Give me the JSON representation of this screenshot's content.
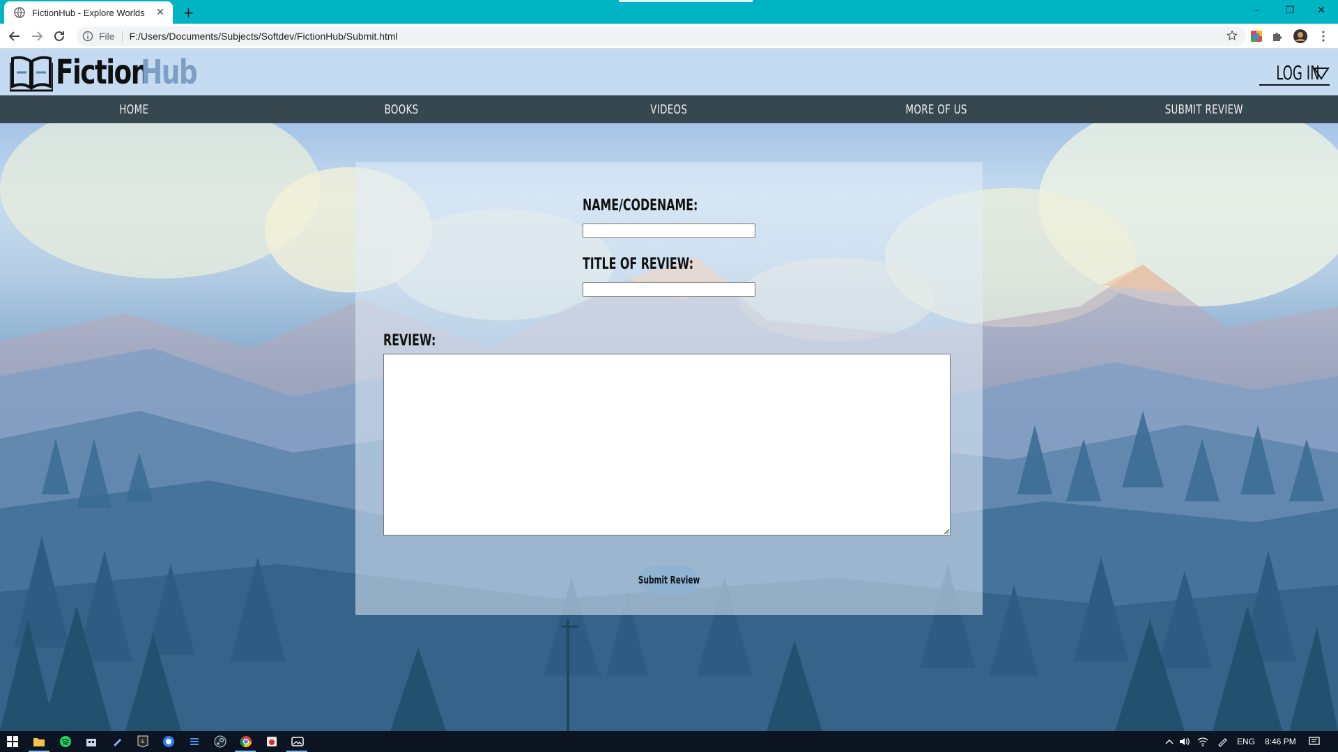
{
  "browser": {
    "tab_title": "FictionHub - Explore Worlds",
    "tab_close": "✕",
    "new_tab": "+",
    "url_scheme": "File",
    "url": "F:/Users/Documents/Subjects/Softdev/FictionHub/Submit.html",
    "window_minimize": "–",
    "window_restore": "❐",
    "window_close": "✕"
  },
  "site": {
    "logo_part1": "Fiction",
    "logo_part2": "Hub",
    "login_label": "LOG IN",
    "nav": [
      "HOME",
      "BOOKS",
      "VIDEOS",
      "MORE OF US",
      "SUBMIT REVIEW"
    ]
  },
  "form": {
    "name_label": "NAME/CODENAME:",
    "name_value": "",
    "title_label": "TITLE OF REVIEW:",
    "title_value": "",
    "review_label": "REVIEW:",
    "review_value": "",
    "submit_label": "Submit Review"
  },
  "taskbar": {
    "language": "ENG",
    "time": "8:46 PM"
  },
  "colors": {
    "chrome_accent": "#00b5c3",
    "nav_bar": "#37474f",
    "header_bg": "#c8ddf3",
    "logo_dark": "#0f0f0f",
    "logo_light": "#7d9fc4",
    "submit_button": "#8eb3d3",
    "taskbar": "#0b1420"
  }
}
